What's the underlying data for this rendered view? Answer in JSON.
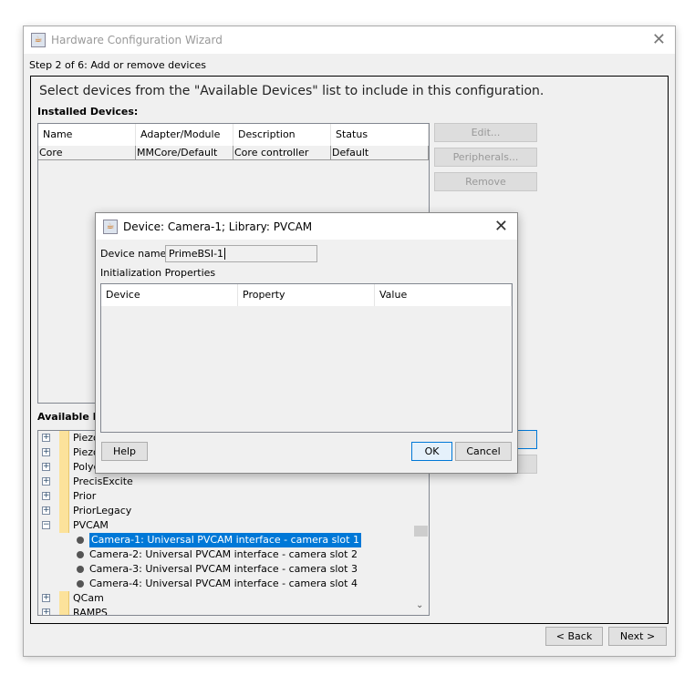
{
  "window": {
    "title": "Hardware Configuration Wizard",
    "step": "Step 2 of 6: Add or remove devices",
    "instruction": "Select devices from the \"Available Devices\" list to include in this configuration.",
    "installed_label": "Installed Devices:",
    "available_label": "Available De",
    "installed_table": {
      "columns": [
        "Name",
        "Adapter/Module",
        "Description",
        "Status"
      ],
      "rows": [
        [
          "Core",
          "MMCore/Default",
          "Core controller",
          "Default"
        ]
      ]
    },
    "side_buttons": {
      "edit": "Edit...",
      "peripherals": "Peripherals...",
      "remove": "Remove"
    },
    "tree": [
      {
        "label": "Piezo",
        "type": "folder",
        "expanded": false
      },
      {
        "label": "Piezo",
        "type": "folder",
        "expanded": false
      },
      {
        "label": "Polyc",
        "type": "folder",
        "expanded": false
      },
      {
        "label": "PrecisExcite",
        "type": "folder",
        "expanded": false
      },
      {
        "label": "Prior",
        "type": "folder",
        "expanded": false
      },
      {
        "label": "PriorLegacy",
        "type": "folder",
        "expanded": false
      },
      {
        "label": "PVCAM",
        "type": "folder",
        "expanded": true
      },
      {
        "label": "Camera-1: Universal PVCAM interface - camera slot 1",
        "type": "device",
        "selected": true
      },
      {
        "label": "Camera-2: Universal PVCAM interface - camera slot 2",
        "type": "device"
      },
      {
        "label": "Camera-3: Universal PVCAM interface - camera slot 3",
        "type": "device"
      },
      {
        "label": "Camera-4: Universal PVCAM interface - camera slot 4",
        "type": "device"
      },
      {
        "label": "QCam",
        "type": "folder",
        "expanded": false
      },
      {
        "label": "RAMPS",
        "type": "folder",
        "expanded": false
      }
    ],
    "nav": {
      "back": "< Back",
      "next": "Next >"
    }
  },
  "dialog": {
    "title": "Device: Camera-1; Library: PVCAM",
    "device_name_label": "Device name:",
    "device_name_value": "PrimeBSI-1",
    "init_label": "Initialization Properties",
    "columns": [
      "Device",
      "Property",
      "Value"
    ],
    "help": "Help",
    "ok": "OK",
    "cancel": "Cancel"
  },
  "colors": {
    "selection": "#0078d7",
    "focus_border": "#0078d7"
  }
}
